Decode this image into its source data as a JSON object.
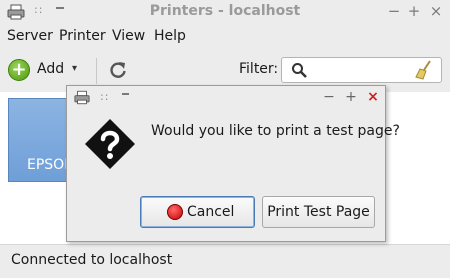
{
  "window": {
    "title": "Printers - localhost",
    "menu_dots": "::",
    "wm_buttons": {
      "minimize": "−",
      "maximize": "+",
      "close": "×"
    }
  },
  "menubar": {
    "items": [
      "Server",
      "Printer",
      "View",
      "Help"
    ]
  },
  "toolbar": {
    "add_label": "Add",
    "add_dropdown": "▾",
    "refresh_icon": "refresh-icon",
    "filter_label": "Filter:",
    "filter_value": "",
    "filter_search_icon": "search-icon",
    "filter_clear_icon": "broom-icon"
  },
  "printers": [
    {
      "label": "EPSON",
      "icon": "printer-icon"
    }
  ],
  "status": {
    "text": "Connected to localhost"
  },
  "dialog": {
    "menu_dots": "::",
    "wm_buttons": {
      "minimize": "−",
      "maximize": "+",
      "close": "×"
    },
    "icon": "question-icon",
    "message": "Would you like to print a test page?",
    "cancel_label": "Cancel",
    "print_label": "Print Test Page"
  },
  "colors": {
    "chrome_bg": "#ececec",
    "selection_tile": "#7aa7dd",
    "close_red": "#cc1f1f",
    "add_green": "#5aa81a"
  }
}
